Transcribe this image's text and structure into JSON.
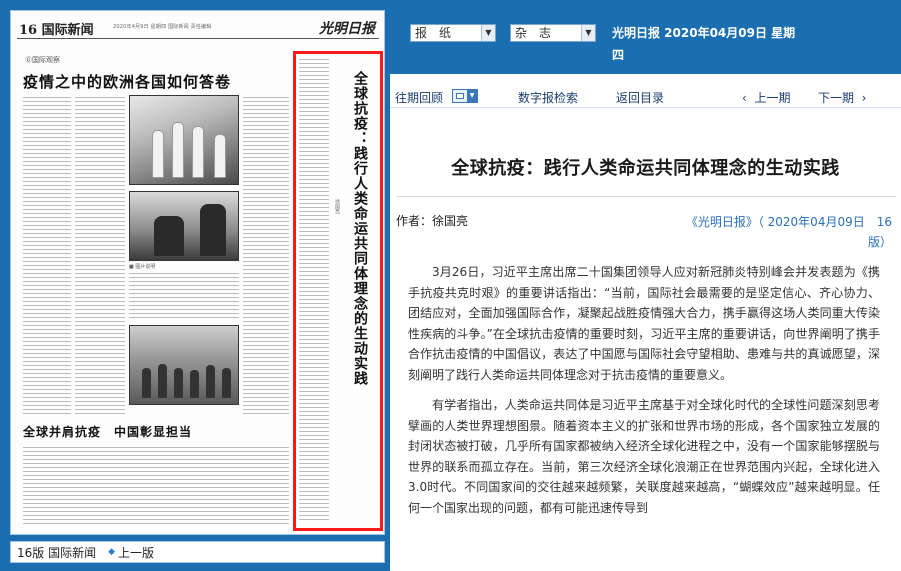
{
  "left_panel": {
    "page_number": "16",
    "section": "国际新闻",
    "logo": "光明日报",
    "date_meta": "2020年4月9日 星期四 国际新闻 责任编辑",
    "kicker": "Ⓖ国际观察",
    "headline": "疫情之中的欧洲各国如何答卷",
    "secondary_headline": "全球并肩抗疫　中国彰显担当",
    "highlighted_article_title": "全球抗疫：践行人类命运共同体理念的生动实践",
    "photo_caption": "■ 图片说明",
    "page_nav": {
      "current": "16版 国际新闻",
      "prev": "上一版"
    }
  },
  "top_bar": {
    "newspaper_select": "报　纸",
    "magazine_select": "杂　志",
    "issue_info": "光明日报 2020年04月09日 星期四"
  },
  "nav": {
    "past_issues": "往期回顾",
    "digital_search": "数字报检索",
    "return_toc": "返回目录",
    "prev_issue": "上一期",
    "next_issue": "下一期"
  },
  "article": {
    "title": "全球抗疫：践行人类命运共同体理念的生动实践",
    "author": "作者：徐国亮",
    "source": "《光明日报》（ 2020年04月09日　16版）",
    "paragraphs": [
      "3月26日，习近平主席出席二十国集团领导人应对新冠肺炎特别峰会并发表题为《携手抗疫共克时艰》的重要讲话指出：“当前，国际社会最需要的是坚定信心、齐心协力、团结应对，全面加强国际合作，凝聚起战胜疫情强大合力，携手赢得这场人类同重大传染性疾病的斗争。”在全球抗击疫情的重要时刻，习近平主席的重要讲话，向世界阐明了携手合作抗击疫情的中国倡议，表达了中国愿与国际社会守望相助、患难与共的真诚愿望，深刻阐明了践行人类命运共同体理念对于抗击疫情的重要意义。",
      "有学者指出，人类命运共同体是习近平主席基于对全球化时代的全球性问题深刻思考擘画的人类世界理想图景。随着资本主义的扩张和世界市场的形成，各个国家独立发展的封闭状态被打破，几乎所有国家都被纳入经济全球化进程之中，没有一个国家能够摆脱与世界的联系而孤立存在。当前，第三次经济全球化浪潮正在世界范围内兴起，全球化进入3.0时代。不同国家间的交往越来越频繁，关联度越来越高，“蝴蝶效应”越来越明显。任何一个国家出现的问题，都有可能迅速传导到"
    ]
  },
  "colors": {
    "header_blue": "#1b6fb1",
    "highlight_red": "#ff1a1a",
    "link_blue": "#2a6fb8"
  }
}
